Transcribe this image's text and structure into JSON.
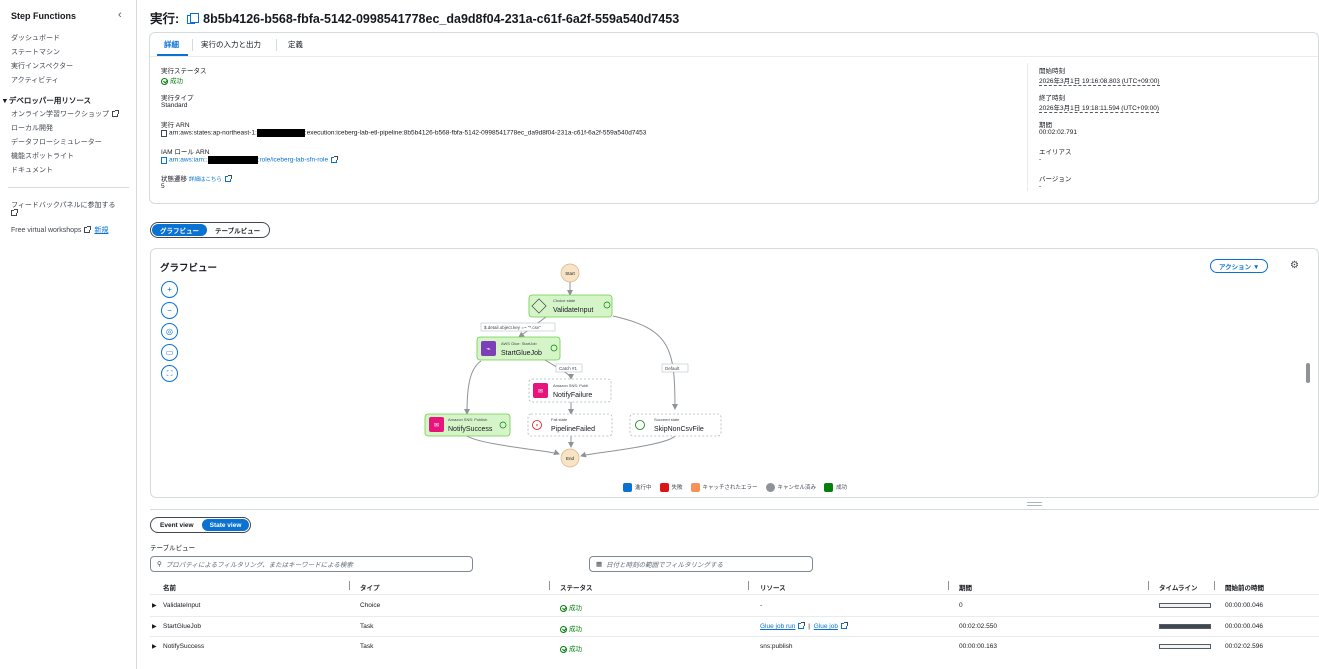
{
  "sidebar": {
    "brand": "Step Functions",
    "items": [
      "ダッシュボード",
      "ステートマシン",
      "実行インスペクター",
      "アクティビティ"
    ],
    "dev_section": "デベロッパー用リソース",
    "dev_items": [
      "オンライン学習ワークショップ",
      "ローカル開発",
      "データフローシミュレーター",
      "機能スポットライト",
      "ドキュメント"
    ],
    "feedback": "フィードバックパネルに参加する",
    "workshops": "Free virtual workshops",
    "new_badge": "新規"
  },
  "header": {
    "prefix": "実行:",
    "execution_id": "8b5b4126-b568-fbfa-5142-0998541778ec_da9d8f04-231a-c61f-6a2f-559a540d7453"
  },
  "tabs": [
    "詳細",
    "実行の入力と出力",
    "定義"
  ],
  "details": {
    "status_label": "実行ステータス",
    "status_value": "成功",
    "type_label": "実行タイプ",
    "type_value": "Standard",
    "arn_label": "実行 ARN",
    "arn_prefix": "arn:aws:states:ap-northeast-1:",
    "arn_suffix": ":execution:iceberg-lab-etl-pipeline:8b5b4126-b568-fbfa-5142-0998541778ec_da9d8f04-231a-c61f-6a2f-559a540d7453",
    "role_label": "IAM ロール ARN",
    "role_prefix": "arn:aws:iam::",
    "role_suffix": ":role/iceberg-lab-sfn-role",
    "transitions_label": "状態遷移",
    "transitions_link": "詳細はこちら",
    "transitions_value": "5",
    "start_label": "開始時刻",
    "start_value": "2026年3月1日 19:16:08.803 (UTC+09:00)",
    "end_label": "終了時刻",
    "end_value": "2026年3月1日 19:18:11.594 (UTC+09:00)",
    "duration_label": "期間",
    "duration_value": "00:02:02.791",
    "alias_label": "エイリアス",
    "alias_value": "-",
    "version_label": "バージョン",
    "version_value": "-"
  },
  "view_toggle": [
    "グラフビュー",
    "テーブルビュー"
  ],
  "graph": {
    "title": "グラフビュー",
    "action_label": "アクション ▼",
    "start": "Start",
    "end": "End",
    "nodes": {
      "validate": {
        "kind": "Choice state",
        "name": "ValidateInput"
      },
      "glue": {
        "kind": "AWS Glue: StartJob",
        "name": "StartGlueJob"
      },
      "notify_failure": {
        "kind": "Amazon SNS: Publi",
        "name": "NotifyFailure"
      },
      "notify_success": {
        "kind": "Amazon SNS: Publish",
        "name": "NotifySuccess"
      },
      "pipeline_failed": {
        "kind": "Fail state",
        "name": "PipelineFailed"
      },
      "skip": {
        "kind": "Succeed state",
        "name": "SkipNonCsvFile"
      }
    },
    "edge_labels": {
      "condition": "$.detail.object.key =~ \"*.csv\"",
      "catch": "Catch #1",
      "default": "Default"
    },
    "legend": [
      {
        "label": "進行中",
        "color": "#0972d3"
      },
      {
        "label": "失敗",
        "color": "#d91515"
      },
      {
        "label": "キャッチされたエラー",
        "color": "#f89256"
      },
      {
        "label": "キャンセル済み",
        "color": "#8d9399"
      },
      {
        "label": "成功",
        "color": "#037f0c"
      }
    ]
  },
  "event_toggle": [
    "Event view",
    "State view"
  ],
  "table": {
    "label": "テーブルビュー",
    "search_placeholder": "プロパティによるフィルタリング、またはキーワードによる検索",
    "date_placeholder": "日付と時刻の範囲でフィルタリングする",
    "columns": [
      "名前",
      "タイプ",
      "ステータス",
      "リソース",
      "期間",
      "タイムライン",
      "開始前の時間"
    ],
    "rows": [
      {
        "name": "ValidateInput",
        "type": "Choice",
        "status": "成功",
        "resource": "-",
        "duration": "0",
        "before": "00:00:00.046",
        "timeline": 0
      },
      {
        "name": "StartGlueJob",
        "type": "Task",
        "status": "成功",
        "resource_link1": "Glue job run",
        "resource_sep": "|",
        "resource_link2": "Glue job",
        "duration": "00:02:02.550",
        "before": "00:00:00.046",
        "timeline": 1
      },
      {
        "name": "NotifySuccess",
        "type": "Task",
        "status": "成功",
        "resource": "sns:publish",
        "duration": "00:00:00.163",
        "before": "00:02:02.596",
        "timeline": 0
      }
    ]
  }
}
